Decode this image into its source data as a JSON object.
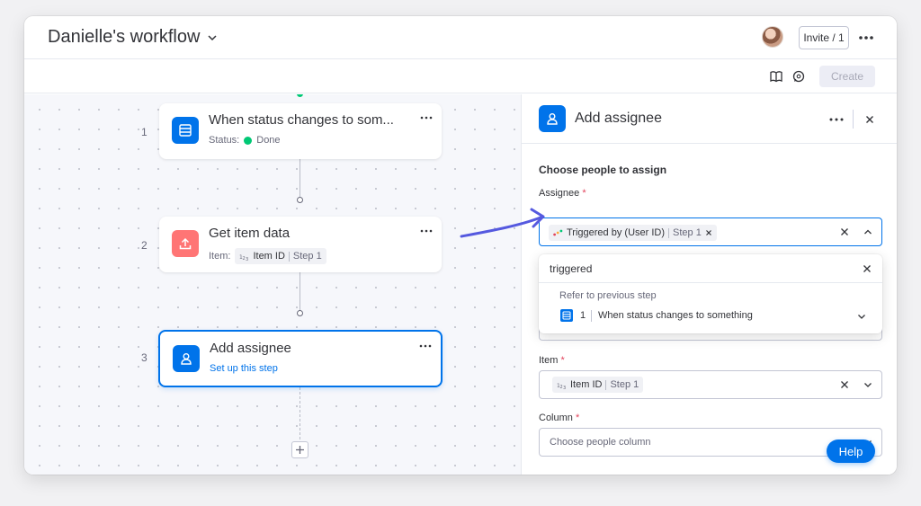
{
  "workflow": {
    "title": "Danielle's workflow"
  },
  "header": {
    "invite_label": "Invite / 1",
    "create_label": "Create"
  },
  "steps": [
    {
      "number": "1",
      "title": "When status changes to som...",
      "sub_label": "Status:",
      "status_value": "Done"
    },
    {
      "number": "2",
      "title": "Get item data",
      "sub_label": "Item:",
      "chip_text": "Item ID",
      "chip_step": "Step 1"
    },
    {
      "number": "3",
      "title": "Add assignee",
      "link": "Set up this step"
    }
  ],
  "panel": {
    "title": "Add assignee",
    "section_title": "Choose people to assign",
    "assignee": {
      "label": "Assignee",
      "chip_text": "Triggered by (User ID)",
      "chip_step": "Step 1"
    },
    "dropdown": {
      "search_value": "triggered",
      "group_label": "Refer to previous step",
      "item_number": "1",
      "item_text": "When status changes to something"
    },
    "item": {
      "label": "Item",
      "chip_text": "Item ID",
      "chip_step": "Step 1"
    },
    "column": {
      "label": "Column",
      "placeholder": "Choose people column"
    },
    "required_mark": "*"
  },
  "help_label": "Help",
  "colors": {
    "accent": "#0073ea",
    "done_green": "#00c875",
    "step2_icon": "#ff7575",
    "arrow": "#5559df"
  }
}
